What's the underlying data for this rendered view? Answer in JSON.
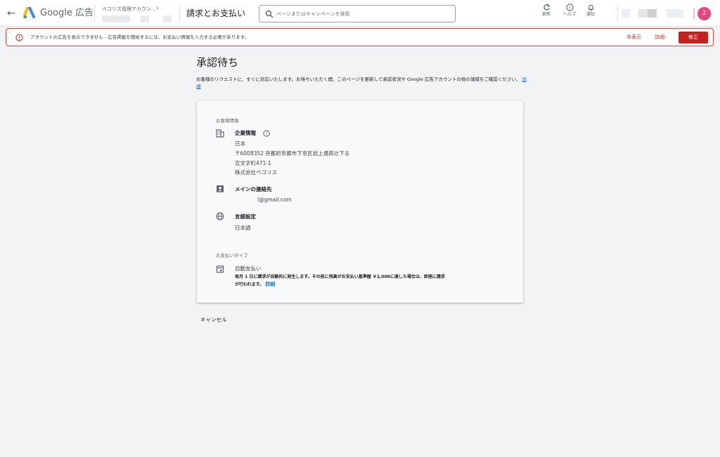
{
  "header": {
    "brand": "Google 広告",
    "account_name": "ペコリス管理アカウン...",
    "page_title": "請求とお支払い",
    "search_placeholder": "ページまたはキャンペーンを検索",
    "tools": [
      {
        "label": "更新",
        "icon": "refresh-icon"
      },
      {
        "label": "ヘルプ",
        "icon": "help-icon"
      },
      {
        "label": "通知",
        "icon": "bell-icon"
      }
    ],
    "avatar_letter": "2",
    "avatar_color": "#e8457c"
  },
  "alert": {
    "message": "アカウントの広告を表示できません - 広告掲載を開始するには、お支払い情報を入力する必要があります。",
    "hide_label": "非表示",
    "detail_label": "詳細",
    "fix_label": "修正",
    "accent": "#c5221f"
  },
  "main": {
    "heading": "承認待ち",
    "description": "お客様のリクエストに、すぐに対応いたします。お待ちいただく間、このページを更新して承認状況や Google 広告アカウントの他の領域をご確認ください。",
    "description_link": "詳細",
    "customer_section_label": "お客様情報",
    "company": {
      "title": "企業情報",
      "lines": [
        "日本",
        "〒6008352 京都府京都市下京区岩上通高辻下る",
        "吉文字町471-1",
        "株式会社ペコリス"
      ]
    },
    "contact": {
      "title": "メインの連絡先",
      "email": "l@gmail.com"
    },
    "language": {
      "title": "言語設定",
      "value": "日本語"
    },
    "payment_section_label": "お支払いタイプ",
    "payment": {
      "type": "自動支払い",
      "note": "毎月 1 日に請求が自動的に発生します。その前に残高がお支払い基準額 ￥2,000に達した場合は、即座に請求が行われます。",
      "note_link": "詳細"
    },
    "cancel_label": "キャンセル"
  }
}
